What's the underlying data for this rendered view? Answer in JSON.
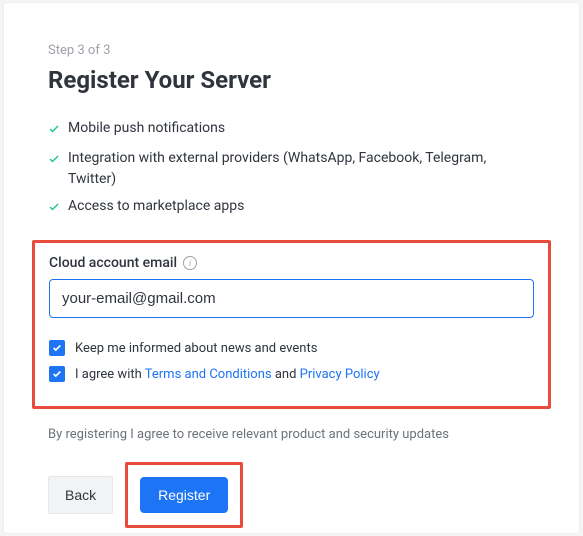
{
  "step": "Step 3 of 3",
  "title": "Register Your Server",
  "features": [
    "Mobile push notifications",
    "Integration with external providers (WhatsApp, Facebook, Telegram, Twitter)",
    "Access to marketplace apps"
  ],
  "email": {
    "label": "Cloud account email",
    "value": "your-email@gmail.com"
  },
  "checkboxes": {
    "news": {
      "checked": true,
      "label": "Keep me informed about news and events"
    },
    "agree": {
      "checked": true,
      "prefix": "I agree with ",
      "terms": "Terms and Conditions",
      "and": " and ",
      "privacy": "Privacy Policy"
    }
  },
  "disclaimer": "By registering I agree to receive relevant product and security updates",
  "buttons": {
    "back": "Back",
    "register": "Register"
  }
}
